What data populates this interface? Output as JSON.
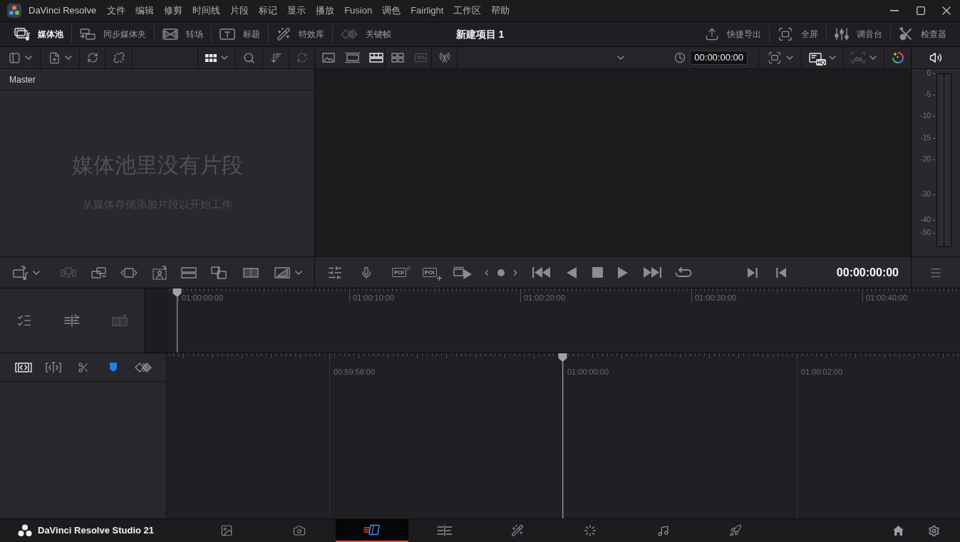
{
  "title_bar": {
    "app_name": "DaVinci Resolve",
    "menu": [
      "文件",
      "编辑",
      "修剪",
      "时间线",
      "片段",
      "标记",
      "显示",
      "播放",
      "Fusion",
      "调色",
      "Fairlight",
      "工作区",
      "帮助"
    ]
  },
  "toolbar": {
    "left": [
      {
        "label": "媒体池",
        "selected": true
      },
      {
        "label": "同步媒体夹",
        "selected": false
      },
      {
        "label": "转场",
        "selected": false
      },
      {
        "label": "标题",
        "selected": false
      },
      {
        "label": "特效库",
        "selected": false
      },
      {
        "label": "关键帧",
        "selected": false
      }
    ],
    "project_title": "新建项目 1",
    "right": [
      {
        "label": "快捷导出",
        "selected": false
      },
      {
        "label": "全屏",
        "selected": false
      },
      {
        "label": "调音台",
        "selected": false
      },
      {
        "label": "检查器",
        "selected": false
      }
    ]
  },
  "media_pool": {
    "bin": "Master",
    "empty_title": "媒体池里没有片段",
    "empty_hint": "从媒体存储添加片段以开始工作"
  },
  "viewer": {
    "view_modes": [
      {
        "selected": false
      },
      {
        "selected": false
      },
      {
        "selected": true
      }
    ],
    "badge": "5m",
    "timecode": "00:00:00:00",
    "quality": "HQ",
    "poi_labels": [
      "POI",
      "POI"
    ],
    "transport_timecode": "00:00:00:00"
  },
  "audio_meter": {
    "scale": [
      "0",
      "-5",
      "-10",
      "-15",
      "-20",
      "-30",
      "-40",
      "-50"
    ],
    "channels": [
      {
        "level": 0
      },
      {
        "level": 0
      }
    ]
  },
  "timeline": {
    "upper_ruler": [
      "01:00:00:00",
      "01:00:10:00",
      "01:00:20:00",
      "01:00:30:00",
      "01:00:40:00"
    ],
    "lower_ruler": [
      "00:59:58:00",
      "01:00:00:00",
      "01:00:02:00"
    ]
  },
  "page_bar": {
    "product": "DaVinci Resolve Studio 21",
    "pages": [
      {
        "selected": false
      },
      {
        "selected": false
      },
      {
        "selected": true
      },
      {
        "selected": false
      },
      {
        "selected": false
      },
      {
        "selected": false
      },
      {
        "selected": false
      },
      {
        "selected": false
      }
    ]
  }
}
